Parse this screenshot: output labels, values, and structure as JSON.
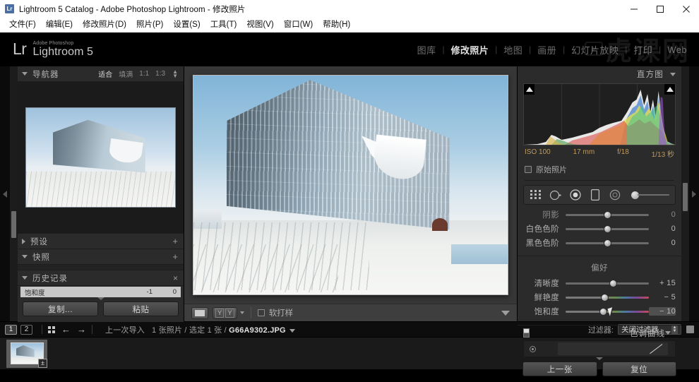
{
  "window": {
    "title": "Lightroom 5 Catalog - Adobe Photoshop Lightroom - 修改照片",
    "app_icon": "Lr",
    "minimize": "minimize-icon",
    "maximize": "maximize-icon",
    "close": "close-icon"
  },
  "menubar": {
    "items": [
      {
        "label": "文件(F)"
      },
      {
        "label": "编辑(E)"
      },
      {
        "label": "修改照片(D)"
      },
      {
        "label": "照片(P)"
      },
      {
        "label": "设置(S)"
      },
      {
        "label": "工具(T)"
      },
      {
        "label": "视图(V)"
      },
      {
        "label": "窗口(W)"
      },
      {
        "label": "帮助(H)"
      }
    ]
  },
  "identity": {
    "lr": "Lr",
    "adobe_line": "Adobe Photoshop",
    "product": "Lightroom 5",
    "watermark": "虎课网"
  },
  "modules": [
    {
      "label": "图库",
      "active": false
    },
    {
      "label": "修改照片",
      "active": true
    },
    {
      "label": "地图",
      "active": false
    },
    {
      "label": "画册",
      "active": false
    },
    {
      "label": "幻灯片放映",
      "active": false
    },
    {
      "label": "打印",
      "active": false
    },
    {
      "label": "Web",
      "active": false
    }
  ],
  "left_panel": {
    "navigator": {
      "title": "导航器",
      "modes": [
        {
          "label": "适合",
          "selected": true
        },
        {
          "label": "填满",
          "selected": false
        },
        {
          "label": "1:1",
          "selected": false
        },
        {
          "label": "1:3",
          "selected": false
        }
      ]
    },
    "sections": [
      {
        "title": "预设",
        "expanded": false,
        "action": "+"
      },
      {
        "title": "快照",
        "expanded": true,
        "action": "+"
      },
      {
        "title": "历史记录",
        "expanded": true,
        "action": "×"
      }
    ],
    "history": [
      {
        "name": "饱和度",
        "delta": "-1",
        "value": "0"
      }
    ],
    "buttons": [
      {
        "label": "复制..."
      },
      {
        "label": "粘贴"
      }
    ]
  },
  "right_panel": {
    "histogram": {
      "title": "直方图",
      "exif": [
        {
          "label": "ISO 100"
        },
        {
          "label": "17 mm"
        },
        {
          "label": "f/18"
        },
        {
          "label": "1/13 秒"
        }
      ],
      "raw_checkbox": {
        "label": "原始照片",
        "checked": false
      }
    },
    "tools": [
      {
        "name": "crop-overlay-icon"
      },
      {
        "name": "spot-removal-icon"
      },
      {
        "name": "red-eye-icon"
      },
      {
        "name": "graduated-filter-icon"
      },
      {
        "name": "radial-filter-icon"
      },
      {
        "name": "adjustment-brush-slider"
      }
    ],
    "basic_sliders_top": [
      {
        "name": "阴影",
        "value": "0",
        "pos": 50,
        "clipped": true
      },
      {
        "name": "白色色阶",
        "value": "0",
        "pos": 50
      },
      {
        "name": "黑色色阶",
        "value": "0",
        "pos": 50
      }
    ],
    "presence": {
      "label": "偏好",
      "sliders": [
        {
          "name": "清晰度",
          "value": "+ 15",
          "pos": 57
        },
        {
          "name": "鲜艳度",
          "value": "− 5",
          "pos": 47,
          "colorful": true
        },
        {
          "name": "饱和度",
          "value": "− 10",
          "pos": 45,
          "colorful": true,
          "active": true
        }
      ]
    },
    "tone_curve": {
      "title": "色调曲线"
    },
    "buttons": [
      {
        "label": "上一张"
      },
      {
        "label": "复位"
      }
    ]
  },
  "toolbar": {
    "view_mode": "loupe-view-icon",
    "before_after": "YY",
    "soft_proofing": {
      "label": "软打样",
      "checked": false
    },
    "toggle": "toolbar-dropdown-icon"
  },
  "filmstrip_bar": {
    "screens": [
      {
        "label": "1",
        "active": true
      },
      {
        "label": "2",
        "active": false
      }
    ],
    "grid_icon": "grid-view-icon",
    "back_icon": "back-arrow-icon",
    "forward_icon": "forward-arrow-icon",
    "source": "上一次导入",
    "counts": "1 张照片 / 选定 1 张 / ",
    "filename": "G66A9302.JPG",
    "filter_label": "过滤器:",
    "filter_value": "关闭过滤器"
  },
  "filmstrip": {
    "thumbnails": [
      {
        "name": "G66A9302.JPG",
        "badge": "±"
      }
    ]
  },
  "colors": {
    "panel_bg": "#2b2b2b",
    "canvas_bg": "#373737",
    "accent_text": "#c09a5a",
    "title_bar": "#ffffff"
  }
}
